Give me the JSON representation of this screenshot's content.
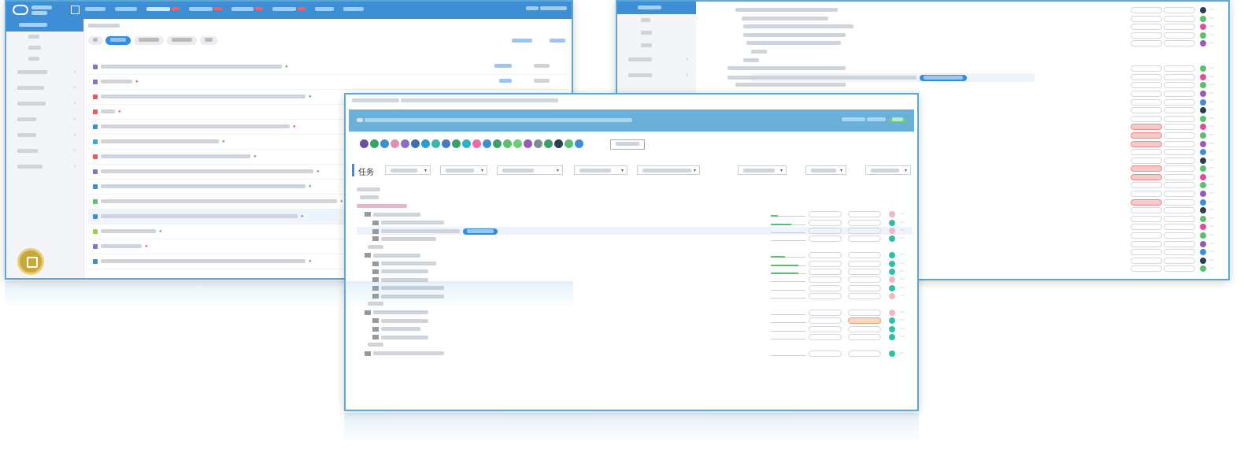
{
  "colors": {
    "accent": "#3d8ed4",
    "header": "#6ab0d8",
    "status_green": "#5bbf6b",
    "status_red": "#ee5a5a"
  },
  "list_window": {
    "logo": "logo-icon",
    "top_tabs": [
      "",
      "",
      "",
      "",
      "",
      "",
      "",
      "",
      ""
    ],
    "sidebar": {
      "active": "",
      "subitems": [
        "",
        "",
        ""
      ],
      "items": [
        "",
        "",
        "",
        "",
        "",
        "",
        ""
      ]
    },
    "rows_count_visible": 17
  },
  "outline_window": {
    "sidebar_active": "",
    "sidebar_subitems": [
      "",
      "",
      ""
    ],
    "highlight_chip": ""
  },
  "tasks_window": {
    "title": "任务",
    "header_text": "",
    "avatar_colors": [
      "#6b4f9a",
      "#3aa06b",
      "#3d8ed4",
      "#e08fb0",
      "#8a6fc9",
      "#3d6fb4",
      "#2a9bd6",
      "#3db5a8",
      "#4a78c9",
      "#3aa06b",
      "#2bb1c9",
      "#ee6aa8",
      "#3d8ed4",
      "#3aa06b",
      "#5bbf6b",
      "#6bcf7a",
      "#9b59b6",
      "#7f8c8d",
      "#3aa06b",
      "#2c3e50",
      "#5bbf6b",
      "#3d8ed4",
      "#5bbf6b",
      "#3d8ed4"
    ],
    "filters": [
      "",
      "",
      "",
      "",
      ""
    ],
    "pager_left": "",
    "pager_right": ""
  }
}
